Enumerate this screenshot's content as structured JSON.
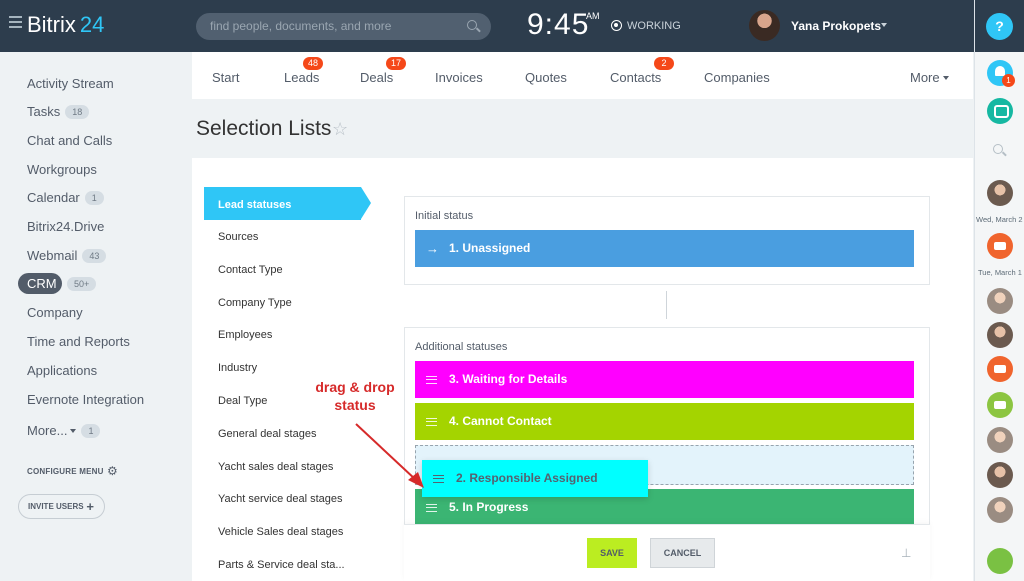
{
  "app": {
    "logo_text": "Bitrix",
    "logo_number": "24"
  },
  "topbar": {
    "search_placeholder": "find people, documents, and more",
    "time": "9:45",
    "ampm": "AM",
    "work_status": "WORKING",
    "user_name": "Yana Prokopets",
    "help_label": "?"
  },
  "sidebar": {
    "items": [
      {
        "label": "Activity Stream"
      },
      {
        "label": "Tasks",
        "count": "18"
      },
      {
        "label": "Chat and Calls"
      },
      {
        "label": "Workgroups"
      },
      {
        "label": "Calendar",
        "count": "1"
      },
      {
        "label": "Bitrix24.Drive"
      },
      {
        "label": "Webmail",
        "count": "43"
      },
      {
        "label": "CRM",
        "count": "50+"
      },
      {
        "label": "Company"
      },
      {
        "label": "Time and Reports"
      },
      {
        "label": "Applications"
      },
      {
        "label": "Evernote Integration"
      },
      {
        "label": "More...",
        "count": "1"
      }
    ],
    "configure_menu": "CONFIGURE MENU",
    "invite_users": "INVITE USERS"
  },
  "tabs": [
    {
      "label": "Start"
    },
    {
      "label": "Leads",
      "badge": "48"
    },
    {
      "label": "Deals",
      "badge": "17"
    },
    {
      "label": "Invoices"
    },
    {
      "label": "Quotes"
    },
    {
      "label": "Contacts",
      "badge": "2"
    },
    {
      "label": "Companies"
    },
    {
      "label": "More"
    }
  ],
  "page_title": "Selection Lists",
  "lists": [
    {
      "label": "Lead statuses",
      "active": true
    },
    {
      "label": "Sources"
    },
    {
      "label": "Contact Type"
    },
    {
      "label": "Company Type"
    },
    {
      "label": "Employees"
    },
    {
      "label": "Industry"
    },
    {
      "label": "Deal Type"
    },
    {
      "label": "General deal stages"
    },
    {
      "label": "Yacht sales deal stages"
    },
    {
      "label": "Yacht service deal stages"
    },
    {
      "label": "Vehicle Sales deal stages"
    },
    {
      "label": "Parts & Service deal sta..."
    }
  ],
  "initial_status": {
    "label": "Initial status",
    "item": {
      "label": "1. Unassigned",
      "color": "#4a9ee0"
    }
  },
  "additional_statuses": {
    "label": "Additional statuses",
    "items": [
      {
        "label": "3. Waiting for Details",
        "color": "#ff00ff"
      },
      {
        "label": "4. Cannot Contact",
        "color": "#a4d400"
      },
      {
        "label": "5. In Progress",
        "color": "#3bb573"
      }
    ],
    "dragging_item": {
      "label": "2. Responsible Assigned",
      "color": "#00ffff"
    }
  },
  "annotation": {
    "line1": "drag & drop",
    "line2": "status",
    "color": "#d62a2a"
  },
  "footer": {
    "save_label": "SAVE",
    "cancel_label": "CANCEL"
  },
  "right_strip": {
    "date1": "Wed, March 2",
    "date2": "Tue, March 1",
    "bell_badge": "1"
  }
}
